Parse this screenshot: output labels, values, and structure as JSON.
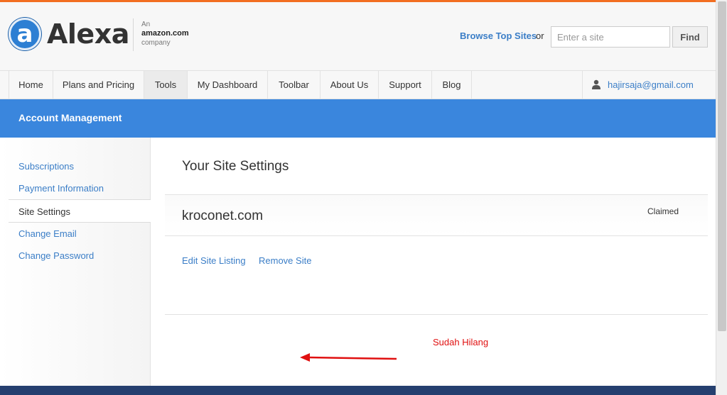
{
  "header": {
    "logo_letter": "a",
    "logo_name": "Alexa",
    "amazon_top": "An",
    "amazon_mid": "amazon.com",
    "amazon_bottom": "company",
    "browse_label": "Browse Top Sites",
    "or_label": "or",
    "search_placeholder": "Enter a site",
    "find_label": "Find"
  },
  "nav": {
    "items": [
      {
        "label": "Home"
      },
      {
        "label": "Plans and Pricing"
      },
      {
        "label": "Tools"
      },
      {
        "label": "My Dashboard"
      },
      {
        "label": "Toolbar"
      },
      {
        "label": "About Us"
      },
      {
        "label": "Support"
      },
      {
        "label": "Blog"
      }
    ],
    "active": "Tools",
    "user_email": "hajirsaja@gmail.com"
  },
  "banner": {
    "title": "Account Management"
  },
  "sidebar": {
    "items": [
      {
        "label": "Subscriptions"
      },
      {
        "label": "Payment Information"
      },
      {
        "label": "Site Settings"
      },
      {
        "label": "Change Email"
      },
      {
        "label": "Change Password"
      }
    ],
    "active": "Site Settings"
  },
  "main": {
    "title": "Your Site Settings",
    "site_name": "kroconet.com",
    "status": "Claimed",
    "edit_link": "Edit Site Listing",
    "remove_link": "Remove Site"
  },
  "annotation": {
    "text": "Sudah Hilang",
    "color": "#e01010"
  },
  "colors": {
    "accent_orange": "#f26e21",
    "banner_blue": "#3a86dd",
    "link_blue": "#3b7ec7",
    "footer_navy": "#253f6f"
  },
  "icons": {
    "user": "user-icon",
    "logo": "alexa-logo-icon"
  }
}
